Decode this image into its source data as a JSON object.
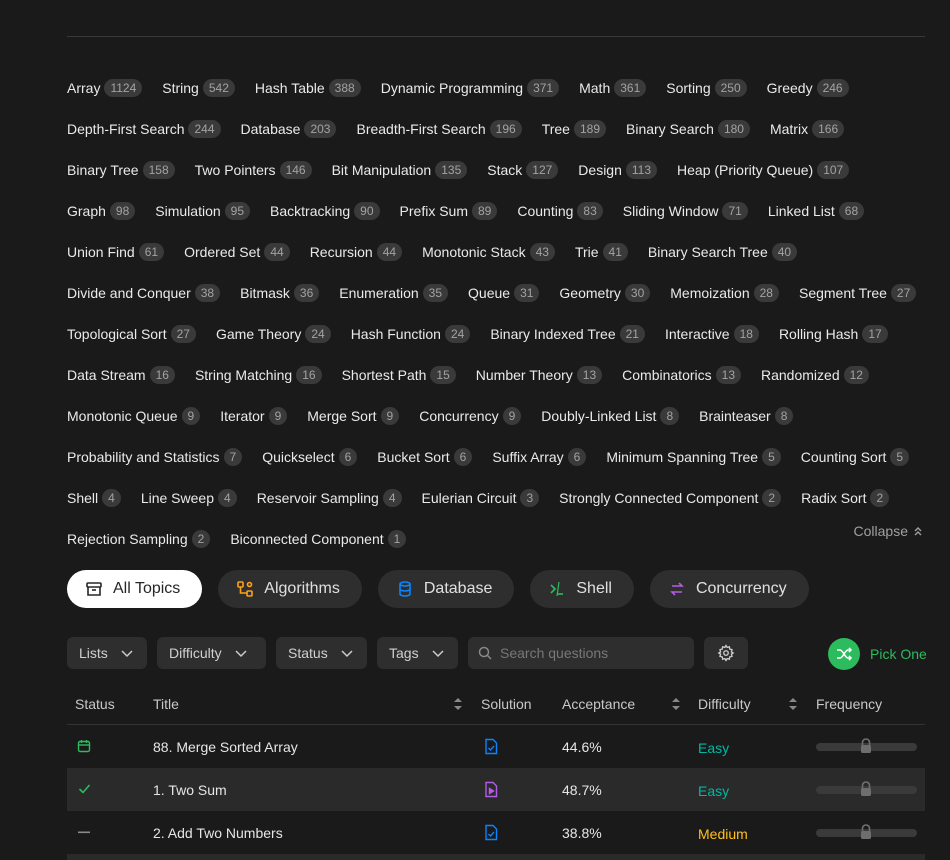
{
  "tags": [
    [
      {
        "name": "Array",
        "count": "1124"
      },
      {
        "name": "String",
        "count": "542"
      },
      {
        "name": "Hash Table",
        "count": "388"
      },
      {
        "name": "Dynamic Programming",
        "count": "371"
      },
      {
        "name": "Math",
        "count": "361"
      },
      {
        "name": "Sorting",
        "count": "250"
      },
      {
        "name": "Greedy",
        "count": "246"
      }
    ],
    [
      {
        "name": "Depth-First Search",
        "count": "244"
      },
      {
        "name": "Database",
        "count": "203"
      },
      {
        "name": "Breadth-First Search",
        "count": "196"
      },
      {
        "name": "Tree",
        "count": "189"
      },
      {
        "name": "Binary Search",
        "count": "180"
      },
      {
        "name": "Matrix",
        "count": "166"
      }
    ],
    [
      {
        "name": "Binary Tree",
        "count": "158"
      },
      {
        "name": "Two Pointers",
        "count": "146"
      },
      {
        "name": "Bit Manipulation",
        "count": "135"
      },
      {
        "name": "Stack",
        "count": "127"
      },
      {
        "name": "Design",
        "count": "113"
      },
      {
        "name": "Heap (Priority Queue)",
        "count": "107"
      }
    ],
    [
      {
        "name": "Graph",
        "count": "98"
      },
      {
        "name": "Simulation",
        "count": "95"
      },
      {
        "name": "Backtracking",
        "count": "90"
      },
      {
        "name": "Prefix Sum",
        "count": "89"
      },
      {
        "name": "Counting",
        "count": "83"
      },
      {
        "name": "Sliding Window",
        "count": "71"
      },
      {
        "name": "Linked List",
        "count": "68"
      }
    ],
    [
      {
        "name": "Union Find",
        "count": "61"
      },
      {
        "name": "Ordered Set",
        "count": "44"
      },
      {
        "name": "Recursion",
        "count": "44"
      },
      {
        "name": "Monotonic Stack",
        "count": "43"
      },
      {
        "name": "Trie",
        "count": "41"
      },
      {
        "name": "Binary Search Tree",
        "count": "40"
      }
    ],
    [
      {
        "name": "Divide and Conquer",
        "count": "38"
      },
      {
        "name": "Bitmask",
        "count": "36"
      },
      {
        "name": "Enumeration",
        "count": "35"
      },
      {
        "name": "Queue",
        "count": "31"
      },
      {
        "name": "Geometry",
        "count": "30"
      },
      {
        "name": "Memoization",
        "count": "28"
      },
      {
        "name": "Segment Tree",
        "count": "27"
      }
    ],
    [
      {
        "name": "Topological Sort",
        "count": "27"
      },
      {
        "name": "Game Theory",
        "count": "24"
      },
      {
        "name": "Hash Function",
        "count": "24"
      },
      {
        "name": "Binary Indexed Tree",
        "count": "21"
      },
      {
        "name": "Interactive",
        "count": "18"
      },
      {
        "name": "Rolling Hash",
        "count": "17"
      }
    ],
    [
      {
        "name": "Data Stream",
        "count": "16"
      },
      {
        "name": "String Matching",
        "count": "16"
      },
      {
        "name": "Shortest Path",
        "count": "15"
      },
      {
        "name": "Number Theory",
        "count": "13"
      },
      {
        "name": "Combinatorics",
        "count": "13"
      },
      {
        "name": "Randomized",
        "count": "12"
      }
    ],
    [
      {
        "name": "Monotonic Queue",
        "count": "9"
      },
      {
        "name": "Iterator",
        "count": "9"
      },
      {
        "name": "Merge Sort",
        "count": "9"
      },
      {
        "name": "Concurrency",
        "count": "9"
      },
      {
        "name": "Doubly-Linked List",
        "count": "8"
      },
      {
        "name": "Brainteaser",
        "count": "8"
      }
    ],
    [
      {
        "name": "Probability and Statistics",
        "count": "7"
      },
      {
        "name": "Quickselect",
        "count": "6"
      },
      {
        "name": "Bucket Sort",
        "count": "6"
      },
      {
        "name": "Suffix Array",
        "count": "6"
      },
      {
        "name": "Minimum Spanning Tree",
        "count": "5"
      },
      {
        "name": "Counting Sort",
        "count": "5"
      }
    ],
    [
      {
        "name": "Shell",
        "count": "4"
      },
      {
        "name": "Line Sweep",
        "count": "4"
      },
      {
        "name": "Reservoir Sampling",
        "count": "4"
      },
      {
        "name": "Eulerian Circuit",
        "count": "3"
      },
      {
        "name": "Strongly Connected Component",
        "count": "2"
      },
      {
        "name": "Radix Sort",
        "count": "2"
      }
    ],
    [
      {
        "name": "Rejection Sampling",
        "count": "2"
      },
      {
        "name": "Biconnected Component",
        "count": "1"
      }
    ]
  ],
  "collapse_label": "Collapse",
  "categories": [
    {
      "label": "All Topics",
      "icon": "archive-icon"
    },
    {
      "label": "Algorithms",
      "icon": "algorithm-nodes-icon",
      "color": "#ffa116"
    },
    {
      "label": "Database",
      "icon": "database-icon",
      "color": "#0a84ff"
    },
    {
      "label": "Shell",
      "icon": "terminal-icon",
      "color": "#2cbb5d"
    },
    {
      "label": "Concurrency",
      "icon": "concurrency-icon",
      "color": "#b35ce6"
    }
  ],
  "filters": {
    "lists": "Lists",
    "difficulty": "Difficulty",
    "status": "Status",
    "tags": "Tags"
  },
  "search": {
    "placeholder": "Search questions"
  },
  "pick_one": "Pick One",
  "table": {
    "headers": {
      "status": "Status",
      "title": "Title",
      "solution": "Solution",
      "acceptance": "Acceptance",
      "difficulty": "Difficulty",
      "frequency": "Frequency"
    },
    "rows": [
      {
        "status": "calendar-icon",
        "title": "88. Merge Sorted Array",
        "solution": "solution-doc-icon",
        "acceptance": "44.6%",
        "difficulty": "Easy"
      },
      {
        "status": "check-icon",
        "title": "1. Two Sum",
        "solution": "video-solution-icon",
        "acceptance": "48.7%",
        "difficulty": "Easy"
      },
      {
        "status": "dash-icon",
        "title": "2. Add Two Numbers",
        "solution": "solution-doc-icon",
        "acceptance": "38.8%",
        "difficulty": "Medium"
      }
    ]
  },
  "colors": {
    "easy": "#00b8a3",
    "medium": "#ffc01e",
    "accent_green": "#2cbb5d"
  }
}
